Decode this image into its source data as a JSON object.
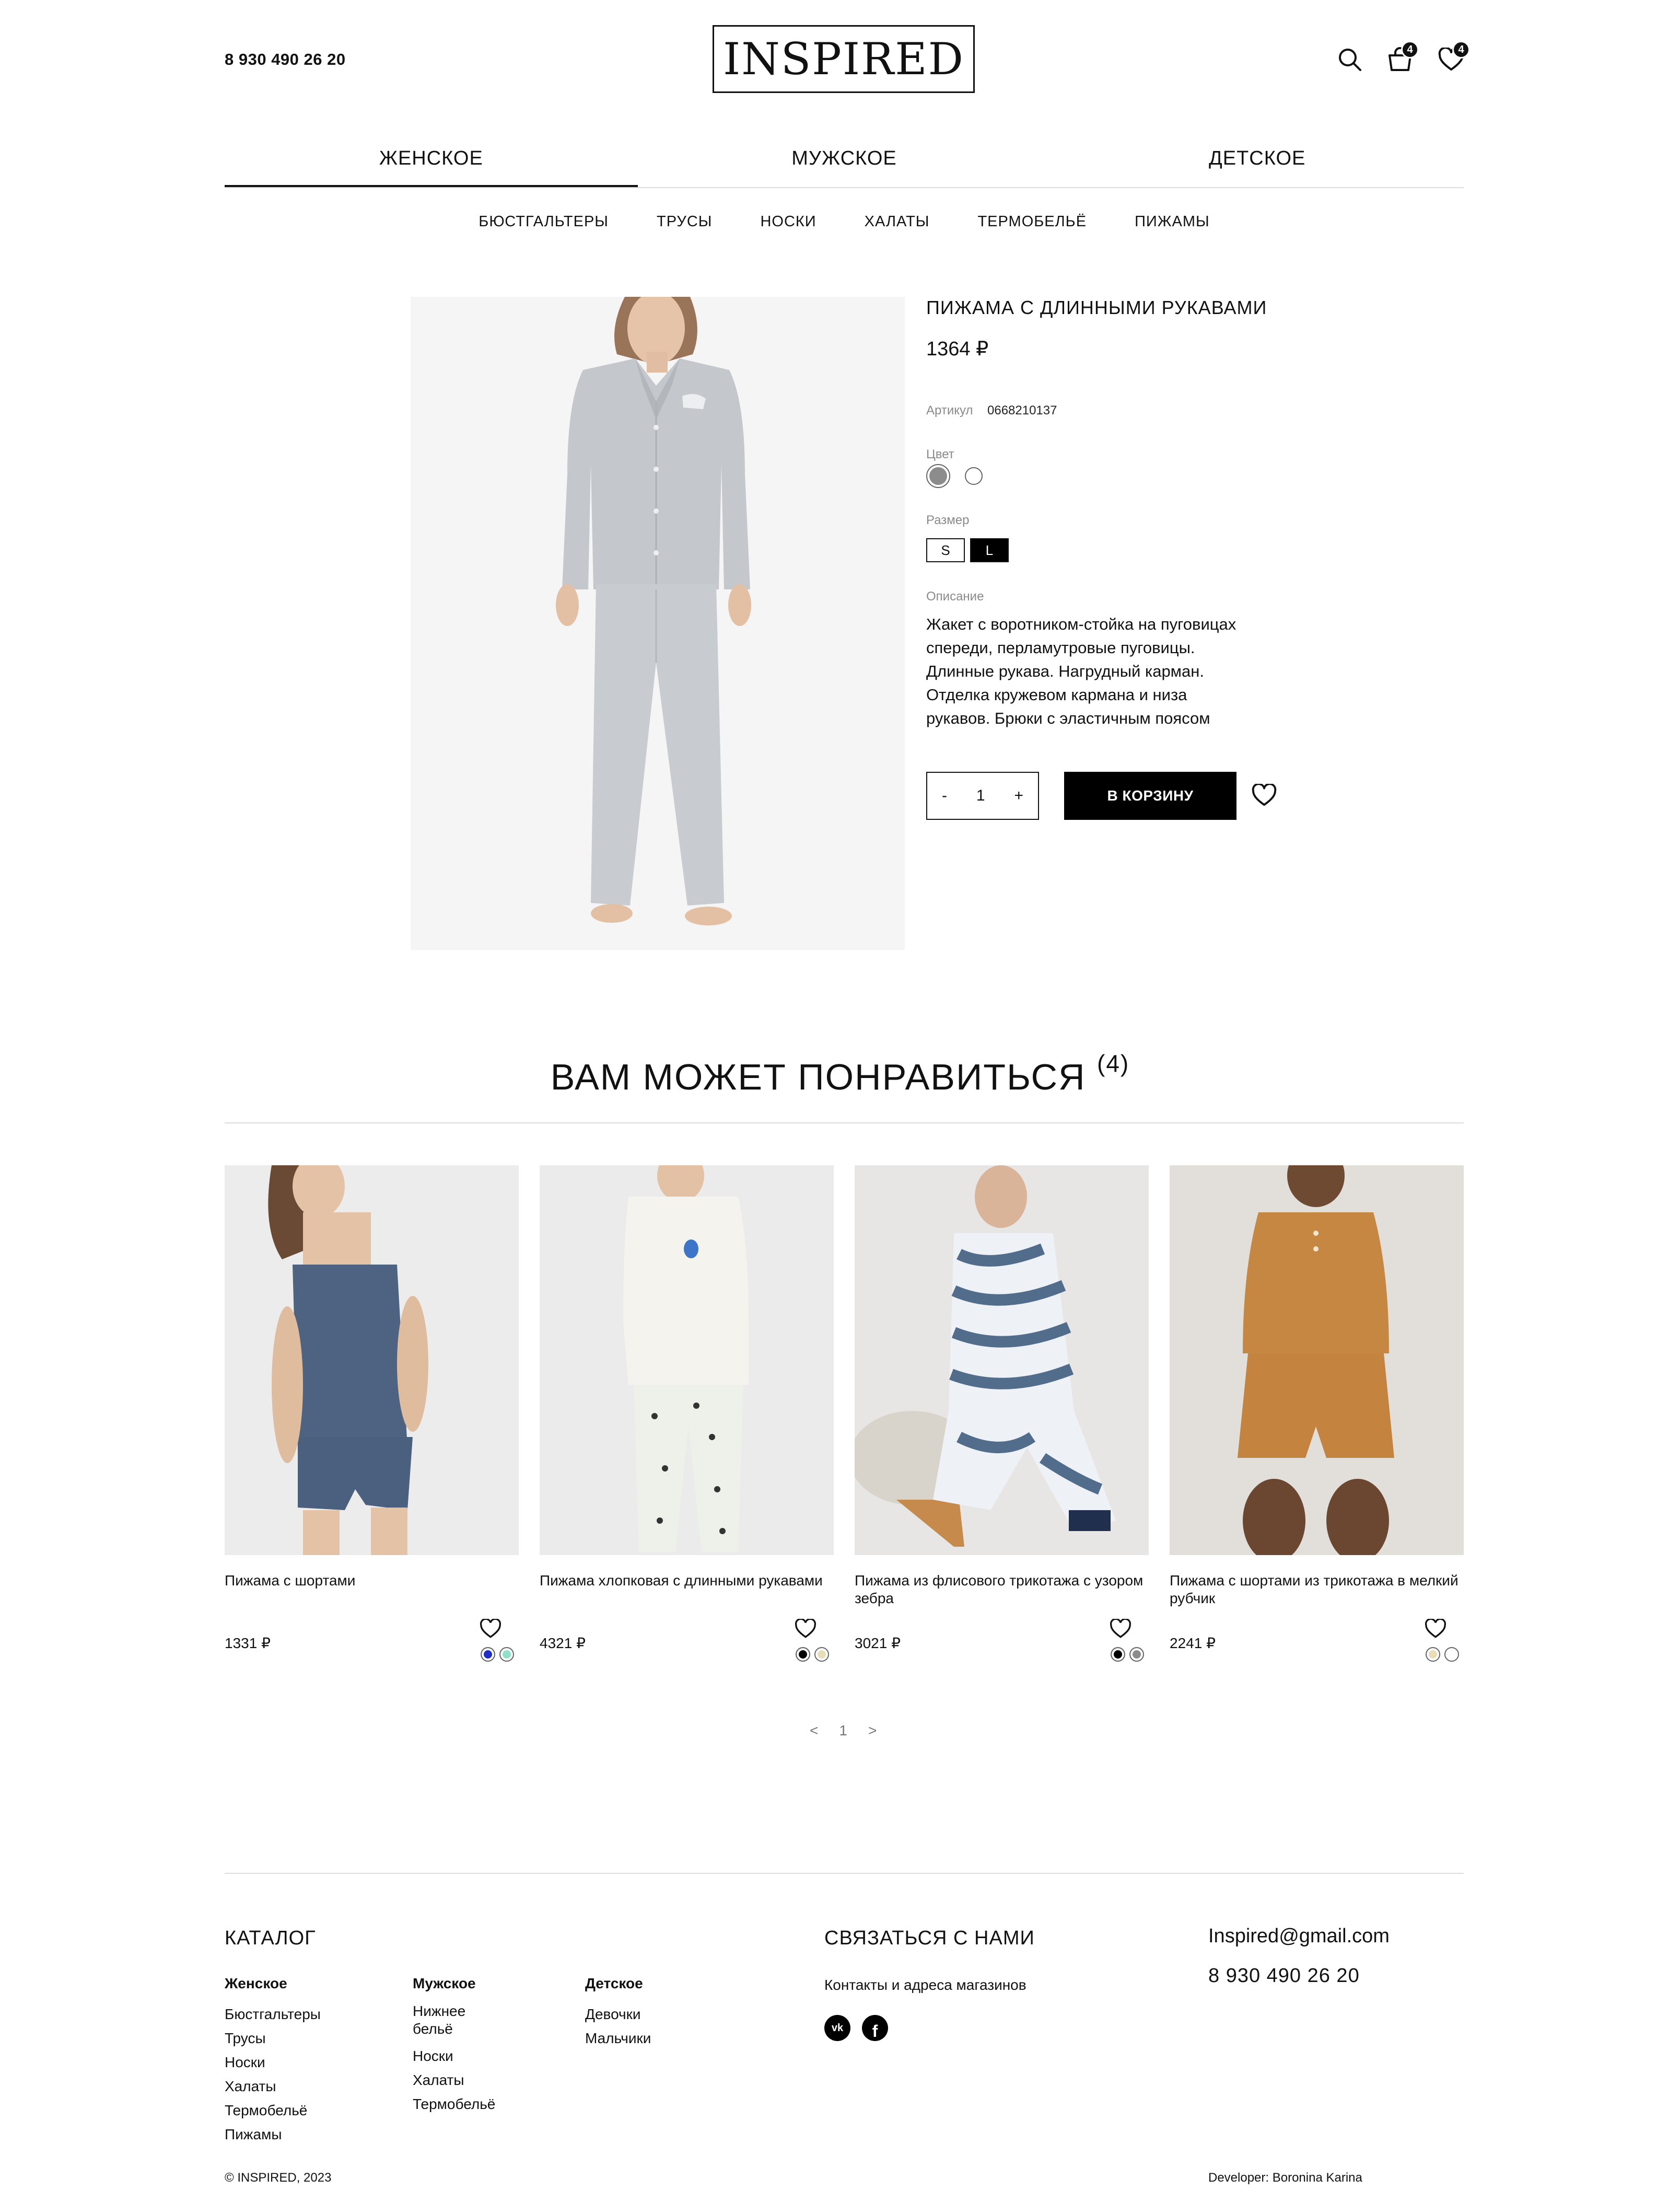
{
  "header": {
    "phone": "8 930 490 26 20",
    "logo": "INSPIRED",
    "cart_count": "4",
    "favorites_count": "4"
  },
  "nav": {
    "tabs": [
      "ЖЕНСКОЕ",
      "МУЖСКОЕ",
      "ДЕТСКОЕ"
    ],
    "active_index": 0,
    "sub": [
      "БЮСТГАЛЬТЕРЫ",
      "ТРУСЫ",
      "НОСКИ",
      "ХАЛАТЫ",
      "ТЕРМОБЕЛЬЁ",
      "ПИЖАМЫ"
    ]
  },
  "product": {
    "title": "ПИЖАМА С ДЛИННЫМИ РУКАВАМИ",
    "price": "1364 ₽",
    "article_label": "Артикул",
    "article": "0668210137",
    "color_label": "Цвет",
    "colors": [
      "#8c8c8c",
      "#ffffff"
    ],
    "size_label": "Размер",
    "sizes": [
      "S",
      "L"
    ],
    "selected_size": "L",
    "description_label": "Описание",
    "description_lines": [
      "Жакет с воротником-стойка на пуговицах",
      "спереди, перламутровые пуговицы.",
      "Длинные рукава. Нагрудный карман.",
      "Отделка кружевом кармана и низа",
      "рукавов. Брюки с эластичным поясом"
    ],
    "qty_minus": "-",
    "qty_value": "1",
    "qty_plus": "+",
    "add_to_cart": "В КОРЗИНУ"
  },
  "recommend": {
    "title": "ВАМ МОЖЕТ ПОНРАВИТЬСЯ",
    "count": "(4)",
    "cards": [
      {
        "name": "Пижама с шортами",
        "price": "1331 ₽",
        "colors": [
          "#1f2fc4",
          "#8fe0c8"
        ]
      },
      {
        "name": "Пижама хлопковая с длинными рукавами",
        "price": "4321 ₽",
        "colors": [
          "#000000",
          "#e9ddb8"
        ]
      },
      {
        "name": "Пижама из флисового трикотажа с узором зебра",
        "price": "3021 ₽",
        "colors": [
          "#000000",
          "#8c8c8c"
        ]
      },
      {
        "name": "Пижама с шортами из трикотажа в мелкий рубчик",
        "price": "2241 ₽",
        "colors": [
          "#e9ddb8",
          "#ffffff"
        ]
      }
    ],
    "pager": {
      "prev": "<",
      "page": "1",
      "next": ">"
    }
  },
  "footer": {
    "catalog_title": "КАТАЛОГ",
    "columns": [
      {
        "title": "Женское",
        "items": [
          "Бюстгальтеры",
          "Трусы",
          "Носки",
          "Халаты",
          "Термобельё",
          "Пижамы"
        ]
      },
      {
        "title": "Мужское",
        "items": [
          "Нижнее бельё",
          "Носки",
          "Халаты",
          "Термобельё"
        ]
      },
      {
        "title": "Детское",
        "items": [
          "Девочки",
          "Мальчики"
        ]
      }
    ],
    "contact_title": "СВЯЗАТЬСЯ С НАМИ",
    "contact_link": "Контакты и адреса магазинов",
    "email": "Inspired@gmail.com",
    "phone": "8 930 490 26 20",
    "copyright": "© INSPIRED, 2023",
    "developer": "Developer: Boronina Karina"
  }
}
